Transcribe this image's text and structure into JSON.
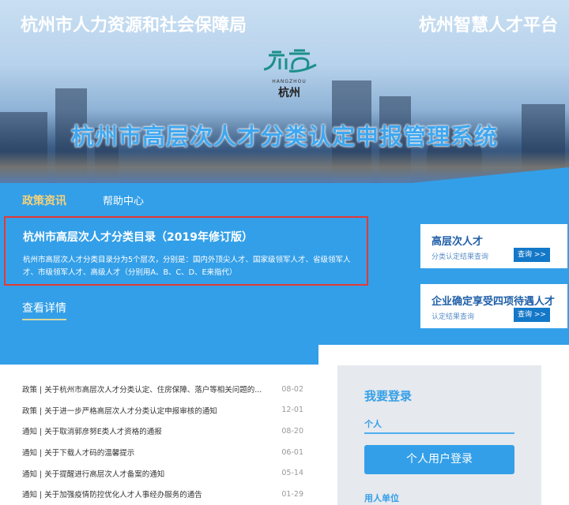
{
  "header": {
    "left_title": "杭州市人力资源和社会保障局",
    "right_title": "杭州智慧人才平台",
    "logo_en": "HANGZHOU",
    "logo_cn": "杭州",
    "system_title": "杭州市高层次人才分类认定申报管理系统"
  },
  "tabs": [
    {
      "label": "政策资讯"
    },
    {
      "label": "帮助中心"
    }
  ],
  "feature": {
    "title": "杭州市高层次人才分类目录（2019年修订版）",
    "desc": "杭州市高层次人才分类目录分为5个层次，分别是：国内外顶尖人才、国家级领军人才、省级领军人才、市级领军人才、高级人才（分别用A、B、C、D、E来指代）",
    "more": "查看详情"
  },
  "cards": [
    {
      "title": "高层次人才",
      "sub": "分类认定结果查询",
      "button": "查询 >>"
    },
    {
      "title": "企业确定享受四项待遇人才",
      "sub": "认定结果查询",
      "button": "查询 >>"
    }
  ],
  "news": [
    {
      "text": "政策 | 关于杭州市高层次人才分类认定、住房保障、落户等相关问题的...",
      "date": "08-02"
    },
    {
      "text": "政策 | 关于进一步严格高层次人才分类认定申报审核的通知",
      "date": "12-01"
    },
    {
      "text": "通知 | 关于取消郭彦努E类人才资格的通报",
      "date": "08-20"
    },
    {
      "text": "通知 | 关于下载人才码的温馨提示",
      "date": "06-01"
    },
    {
      "text": "通知 | 关于提醒进行高层次人才备案的通知",
      "date": "05-14"
    },
    {
      "text": "通知 | 关于加强疫情防控优化人才人事经办服务的通告",
      "date": "01-29"
    }
  ],
  "login": {
    "title": "我要登录",
    "personal": "个人",
    "personal_button": "个人用户登录",
    "employer": "用人单位"
  }
}
